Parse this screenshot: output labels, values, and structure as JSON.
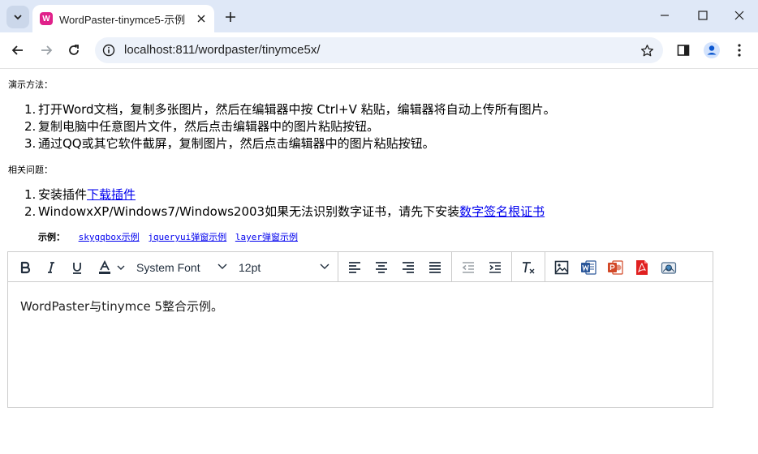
{
  "browser": {
    "tab_title": "WordPaster-tinymce5-示例",
    "favicon_letter": "W",
    "url": "localhost:811/wordpaster/tinymce5x/"
  },
  "page": {
    "demo_heading": "演示方法：",
    "demo_steps": [
      {
        "num": "1.",
        "text": "打开Word文档，复制多张图片，然后在编辑器中按 Ctrl+V 粘贴，编辑器将自动上传所有图片。"
      },
      {
        "num": "2.",
        "text": "复制电脑中任意图片文件，然后点击编辑器中的图片粘贴按钮。"
      },
      {
        "num": "3.",
        "text": "通过QQ或其它软件截屏，复制图片，然后点击编辑器中的图片粘贴按钮。"
      }
    ],
    "faq_heading": "相关问题：",
    "faq_items": [
      {
        "num": "1.",
        "text": "安装插件",
        "link": "下载插件"
      },
      {
        "num": "2.",
        "text": "WindowxXP/Windows7/Windows2003如果无法识别数字证书，请先下安装",
        "link": "数字签名根证书"
      }
    ],
    "examples_lead": "示例：",
    "examples": [
      "skygqbox示例",
      "jqueryui弹窗示例",
      "layer弹窗示例"
    ]
  },
  "editor": {
    "font_family": "System Font",
    "font_size": "12pt",
    "content": "WordPaster与tinymce 5整合示例。"
  },
  "colors": {
    "word": "#2b579a",
    "ppt": "#d24726",
    "pdf": "#e02020",
    "favicon": "#e0218a"
  }
}
